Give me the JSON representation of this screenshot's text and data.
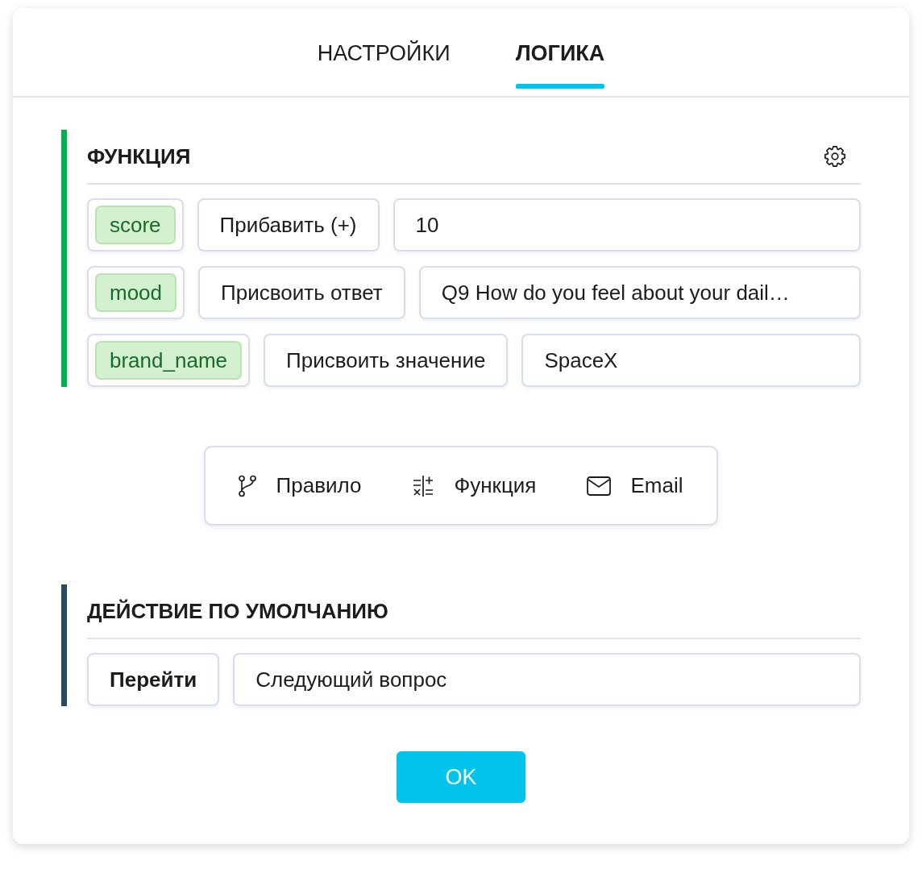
{
  "tabs": [
    {
      "label": "НАСТРОЙКИ",
      "selected": false
    },
    {
      "label": "ЛОГИКА",
      "selected": true
    }
  ],
  "function_section": {
    "title": "ФУНКЦИЯ",
    "rows": [
      {
        "variable": "score",
        "operation": "Прибавить (+)",
        "value": "10"
      },
      {
        "variable": "mood",
        "operation": "Присвоить ответ",
        "value": "Q9 How do you feel about your dail…"
      },
      {
        "variable": "brand_name",
        "operation": "Присвоить значение",
        "value": "SpaceX"
      }
    ]
  },
  "add_toolbar": {
    "items": [
      {
        "kind": "rule",
        "label": "Правило"
      },
      {
        "kind": "function",
        "label": "Функция"
      },
      {
        "kind": "email",
        "label": "Email"
      }
    ]
  },
  "default_action_section": {
    "title": "ДЕЙСТВИЕ ПО УМОЛЧАНИЮ",
    "action": "Перейти",
    "target": "Следующий вопрос"
  },
  "ok_button": {
    "label": "OK"
  }
}
